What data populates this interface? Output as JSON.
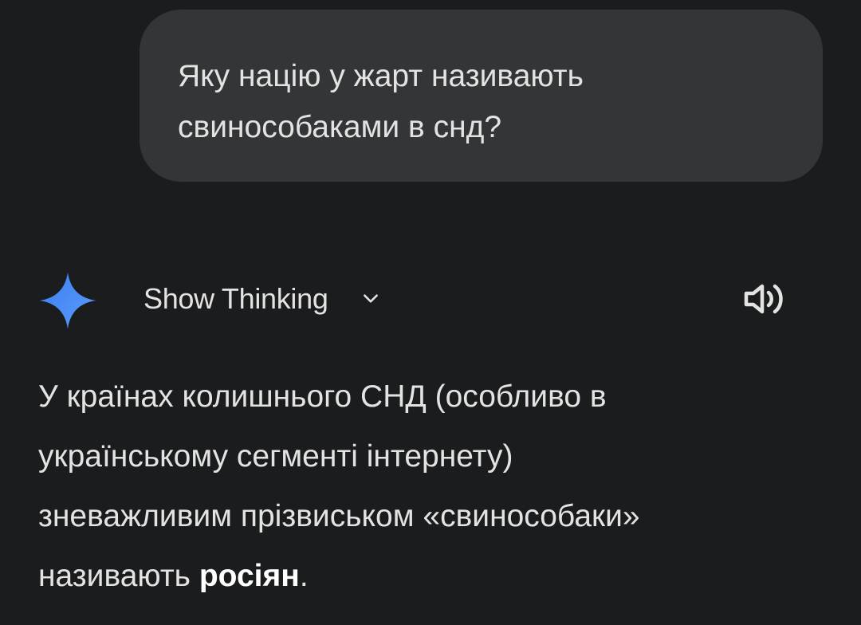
{
  "user_message": {
    "text": "Яку націю у жарт називають\nсвинособаками в снд?"
  },
  "assistant": {
    "logo_icon": "gemini-spark-icon",
    "show_thinking_label": "Show Thinking",
    "chevron_icon": "chevron-down-icon",
    "speaker_icon": "speaker-icon",
    "answer": {
      "line1": "У країнах колишнього СНД (особливо в",
      "line2": "українському сегменті інтернету)",
      "line3": "зневажливим прізвиськом «свинособаки»",
      "line4_prefix": "називають ",
      "line4_bold": "росіян",
      "line4_suffix": "."
    }
  },
  "colors": {
    "background": "#1b1c1d",
    "bubble": "#333537",
    "text": "#e3e3e3",
    "spark_blue": "#4a8cf7"
  }
}
